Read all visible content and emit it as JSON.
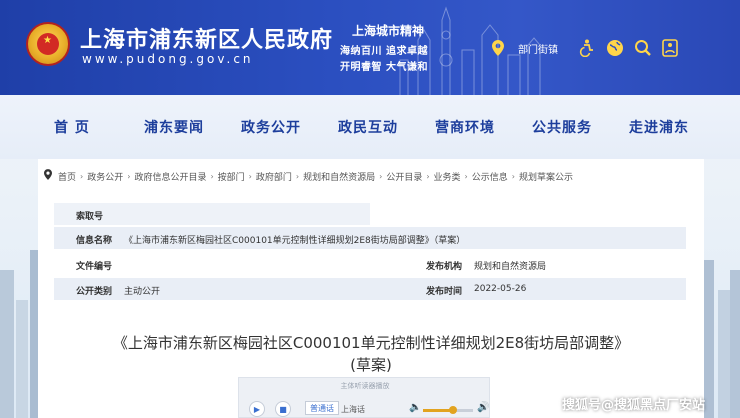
{
  "header": {
    "site_name": "上海市浦东新区人民政府",
    "site_url": "www.pudong.gov.cn",
    "spirit_title": "上海城市精神",
    "spirit_line1": "海纳百川  追求卓越",
    "spirit_line2": "开明睿智  大气谦和",
    "dept_label": "部门街镇",
    "icons": [
      "location-pin-icon",
      "accessibility-icon",
      "globe-icon",
      "search-icon",
      "elder-mode-icon"
    ],
    "icon_color": "#ffd54a"
  },
  "nav": {
    "items": [
      "首 页",
      "浦东要闻",
      "政务公开",
      "政民互动",
      "营商环境",
      "公共服务",
      "走进浦东"
    ]
  },
  "breadcrumb": {
    "items": [
      "首页",
      "政务公开",
      "政府信息公开目录",
      "按部门",
      "政府部门",
      "规划和自然资源局",
      "公开目录",
      "业务类",
      "公示信息",
      "规划草案公示"
    ]
  },
  "meta": {
    "index_label": "索取号",
    "index_value": "",
    "info_name_label": "信息名称",
    "info_name_value": "《上海市浦东新区梅园社区C000101单元控制性详细规划2E8街坊局部调整》（草案）",
    "doc_no_label": "文件编号",
    "doc_no_value": "",
    "issuer_label": "发布机构",
    "issuer_value": "规划和自然资源局",
    "category_label": "公开类别",
    "category_value": "主动公开",
    "date_label": "发布时间",
    "date_value": "2022-05-26"
  },
  "document": {
    "title": "《上海市浦东新区梅园社区C000101单元控制性详细规划2E8街坊局部调整》",
    "subtitle": "(草案)"
  },
  "reader": {
    "title": "主体听读器播放",
    "mode": "普通话",
    "lang": "上海话",
    "volume": 0.6
  },
  "watermark": "搜狐号@搜狐黑点厂安站"
}
